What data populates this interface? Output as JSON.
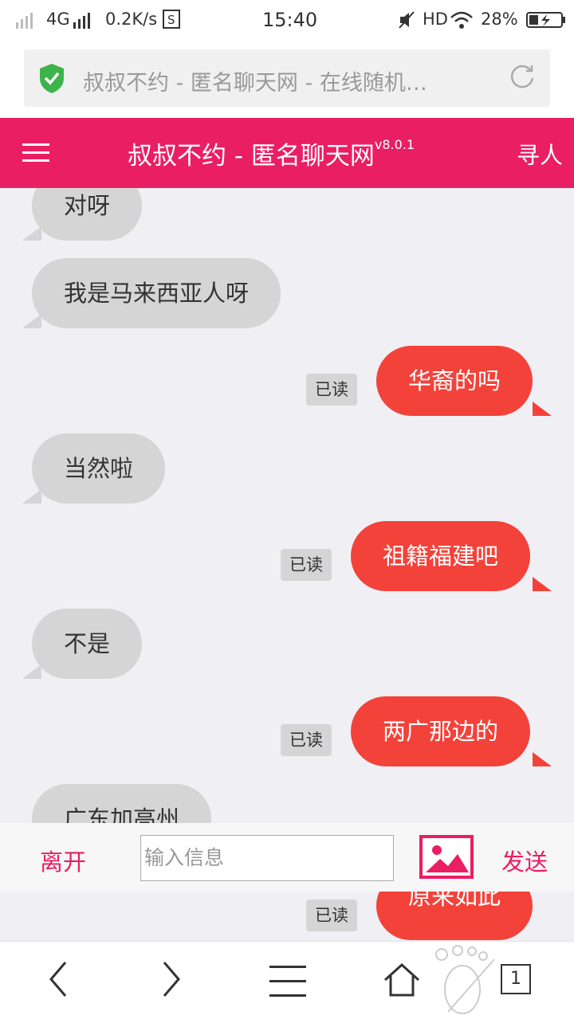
{
  "status_bar": {
    "network": "4G",
    "speed": "0.2K/s",
    "time": "15:40",
    "hd": "HD",
    "battery": "28%"
  },
  "browser": {
    "url_text": "叔叔不约  -    匿名聊天网 - 在线随机…"
  },
  "app": {
    "title": "叔叔不约 - 匿名聊天网",
    "version": "v8.0.1",
    "find_label": "寻人",
    "brand_color": "#ea1e63"
  },
  "messages": [
    {
      "dir": "in",
      "text": "对呀"
    },
    {
      "dir": "in",
      "text": "我是马来西亚人呀"
    },
    {
      "dir": "out",
      "text": "华裔的吗",
      "read": "已读"
    },
    {
      "dir": "in",
      "text": "当然啦"
    },
    {
      "dir": "out",
      "text": "祖籍福建吧",
      "read": "已读"
    },
    {
      "dir": "in",
      "text": "不是"
    },
    {
      "dir": "out",
      "text": "两广那边的",
      "read": "已读"
    },
    {
      "dir": "in",
      "text": "广东加高州"
    },
    {
      "dir": "out",
      "text": "原来如此",
      "read": "已读"
    }
  ],
  "input_bar": {
    "leave_label": "离开",
    "placeholder": "输入信息",
    "value": "",
    "send_label": "发送"
  },
  "bottom_nav": {
    "tabs_count": "1"
  }
}
